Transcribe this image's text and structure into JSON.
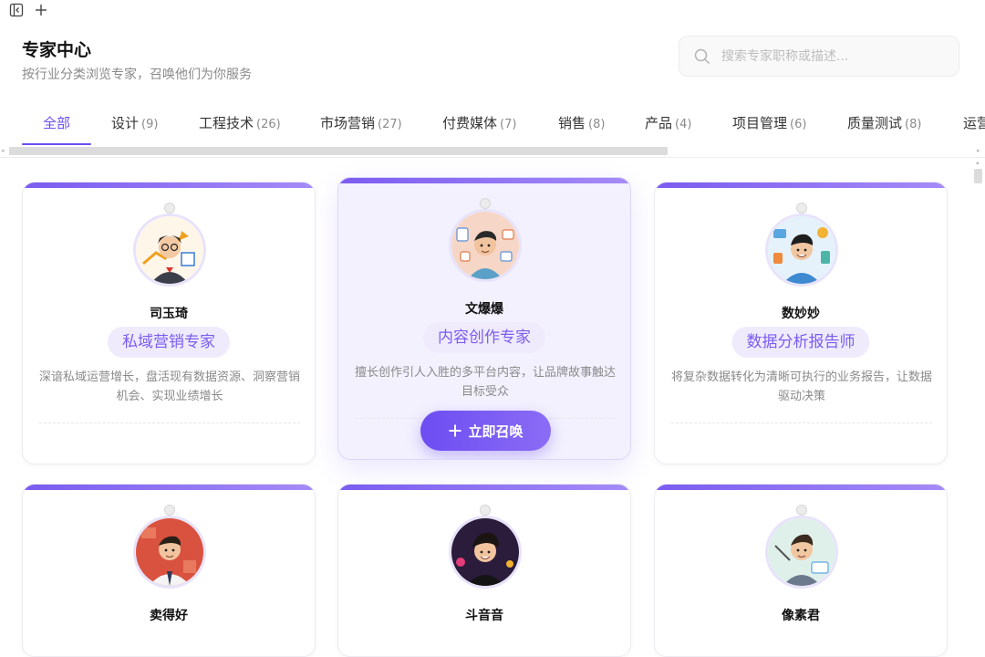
{
  "header": {
    "title": "专家中心",
    "subtitle": "按行业分类浏览专家，召唤他们为你服务"
  },
  "search": {
    "placeholder": "搜索专家职称或描述..."
  },
  "tabs": [
    {
      "label": "全部",
      "count": ""
    },
    {
      "label": "设计",
      "count": "(9)"
    },
    {
      "label": "工程技术",
      "count": "(26)"
    },
    {
      "label": "市场营销",
      "count": "(27)"
    },
    {
      "label": "付费媒体",
      "count": "(7)"
    },
    {
      "label": "销售",
      "count": "(8)"
    },
    {
      "label": "产品",
      "count": "(4)"
    },
    {
      "label": "项目管理",
      "count": "(6)"
    },
    {
      "label": "质量测试",
      "count": "(8)"
    },
    {
      "label": "运营",
      "count": ""
    }
  ],
  "experts": [
    {
      "name": "司玉琦",
      "title": "私域营销专家",
      "desc": "深谙私域运营增长，盘活现有数据资源、洞察营销机会、实现业绩增长"
    },
    {
      "name": "文爆爆",
      "title": "内容创作专家",
      "desc": "擅长创作引人入胜的多平台内容，让品牌故事触达目标受众"
    },
    {
      "name": "数妙妙",
      "title": "数据分析报告师",
      "desc": "将复杂数据转化为清晰可执行的业务报告，让数据驱动决策"
    },
    {
      "name": "卖得好",
      "title": "",
      "desc": ""
    },
    {
      "name": "斗音音",
      "title": "",
      "desc": ""
    },
    {
      "name": "像素君",
      "title": "",
      "desc": ""
    }
  ],
  "summon_button": {
    "label": "立即召唤"
  },
  "icons": {
    "sidebar_toggle": "sidebar-collapse-icon",
    "new_tab": "plus-icon",
    "search": "search-icon",
    "summon": "plus-icon"
  },
  "colors": {
    "accent": "#6d4df2",
    "badge_bg": "#efebfd",
    "featured_bg": "#f3f1fe"
  }
}
